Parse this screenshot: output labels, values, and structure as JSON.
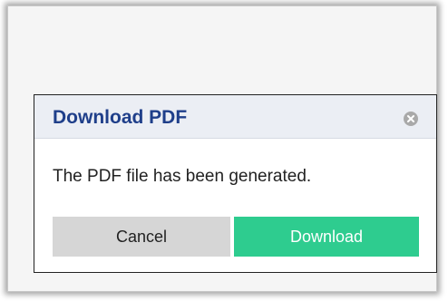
{
  "dialog": {
    "title": "Download PDF",
    "message": "The PDF file has been generated.",
    "cancel_label": "Cancel",
    "download_label": "Download",
    "close_icon": "close-circle-icon"
  },
  "colors": {
    "title": "#1f3f8a",
    "header_bg": "#ebeef4",
    "download_bg": "#2ecc8f",
    "cancel_bg": "#d6d6d6"
  }
}
